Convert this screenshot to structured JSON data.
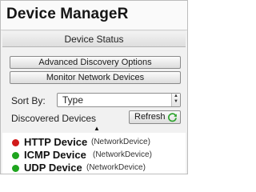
{
  "app": {
    "title": "Device ManageR"
  },
  "header": {
    "status_button": "Device Status"
  },
  "actions": {
    "advanced_discovery": "Advanced Discovery Options",
    "monitor_network": "Monitor Network Devices"
  },
  "sort": {
    "label": "Sort By:",
    "value": "Type"
  },
  "discovered": {
    "label": "Discovered Devices",
    "refresh_label": "Refresh"
  },
  "devices": [
    {
      "name": "HTTP Device",
      "type": "(NetworkDevice)",
      "status_color": "#d11a1a"
    },
    {
      "name": "ICMP Device",
      "type": "(NetworkDevice)",
      "status_color": "#1ea51e"
    },
    {
      "name": "UDP Device",
      "type": "(NetworkDevice)",
      "status_color": "#1ea51e"
    }
  ],
  "icons": {
    "refresh": "refresh-icon",
    "sort_indicator": "sort-ascending-icon",
    "stepper": "stepper-icon"
  }
}
